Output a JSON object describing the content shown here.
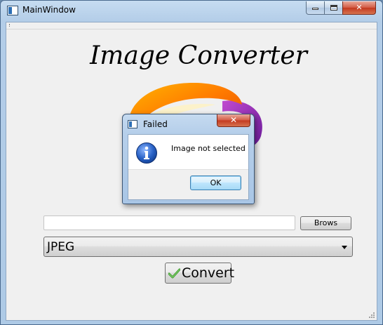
{
  "window": {
    "title": "MainWindow",
    "minimize_glyph": "minimize",
    "maximize_glyph": "maximize",
    "close_glyph": "✕"
  },
  "main": {
    "app_title": "Image Converter",
    "path_input": {
      "value": "",
      "placeholder": ""
    },
    "browse_label": "Brows",
    "format_select": {
      "selected": "JPEG"
    },
    "convert_label": "Convert"
  },
  "dialog": {
    "title": "Failed",
    "message": "Image not selected",
    "ok_label": "OK",
    "close_glyph": "✕"
  },
  "icons": {
    "app": "window-icon",
    "logo": "image-converter-logo",
    "info": "information-icon",
    "convert": "checkmark-icon"
  },
  "colors": {
    "title_bar": "#b3cde8",
    "close_button": "#c3391f",
    "client_bg": "#f0f0f0",
    "info_icon": "#1e5bb8",
    "check_icon": "#3a9a2a"
  }
}
